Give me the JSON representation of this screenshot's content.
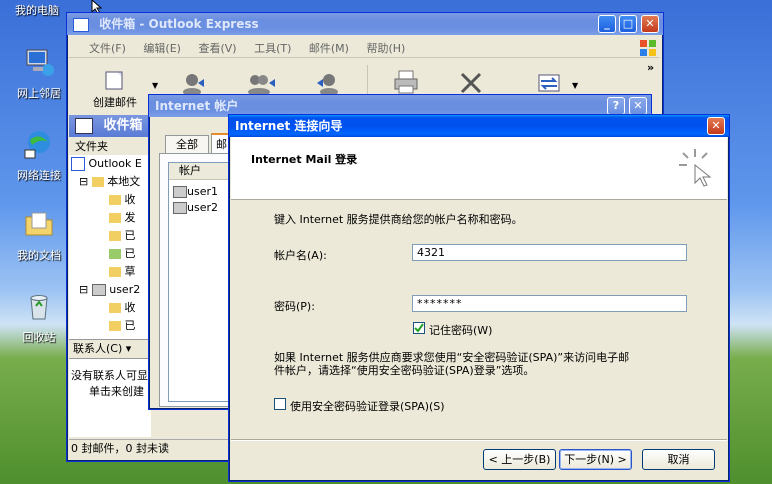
{
  "desktop": {
    "icons": [
      {
        "label": "我的电脑"
      },
      {
        "label": "网上邻居"
      },
      {
        "label": "网络连接"
      },
      {
        "label": "我的文档"
      },
      {
        "label": "回收站"
      }
    ]
  },
  "outlook": {
    "title": "收件箱 - Outlook Express",
    "menu": [
      "文件(F)",
      "编辑(E)",
      "查看(V)",
      "工具(T)",
      "邮件(M)",
      "帮助(H)"
    ],
    "toolbar": {
      "create_mail": "创建邮件"
    },
    "folder_header": "收件箱",
    "folders_label": "文件夹",
    "tree": {
      "root": "Outlook E",
      "local": "本地文",
      "local_children": [
        "收",
        "发",
        "已",
        "已",
        "草"
      ],
      "user2": "user2",
      "user2_children": [
        "收",
        "已"
      ]
    },
    "contacts_label": "联系人(C)",
    "contacts_text": [
      "没有联系人可显",
      "单击来创建"
    ],
    "status": "0 封邮件，0 封未读"
  },
  "accounts": {
    "title": "Internet 帐户",
    "tabs": [
      "全部",
      "邮"
    ],
    "list_header": "帐户",
    "accounts": [
      "user1",
      "user2"
    ]
  },
  "wizard": {
    "title": "Internet 连接向导",
    "header": "Internet Mail 登录",
    "intro": "键入 Internet 服务提供商给您的帐户名称和密码。",
    "account_label": "帐户名(A):",
    "account_value": "4321",
    "password_label": "密码(P):",
    "password_value": "*******",
    "remember_label": "记住密码(W)",
    "remember_checked": true,
    "spa_text_1": "如果 Internet 服务供应商要求您使用“安全密码验证(SPA)”来访问电子邮",
    "spa_text_2": "件帐户，请选择“使用安全密码验证(SPA)登录”选项。",
    "spa_label": "使用安全密码验证登录(SPA)(S)",
    "spa_checked": false,
    "back_button": "< 上一步(B)",
    "next_button": "下一步(N) >",
    "cancel_button": "取消"
  }
}
